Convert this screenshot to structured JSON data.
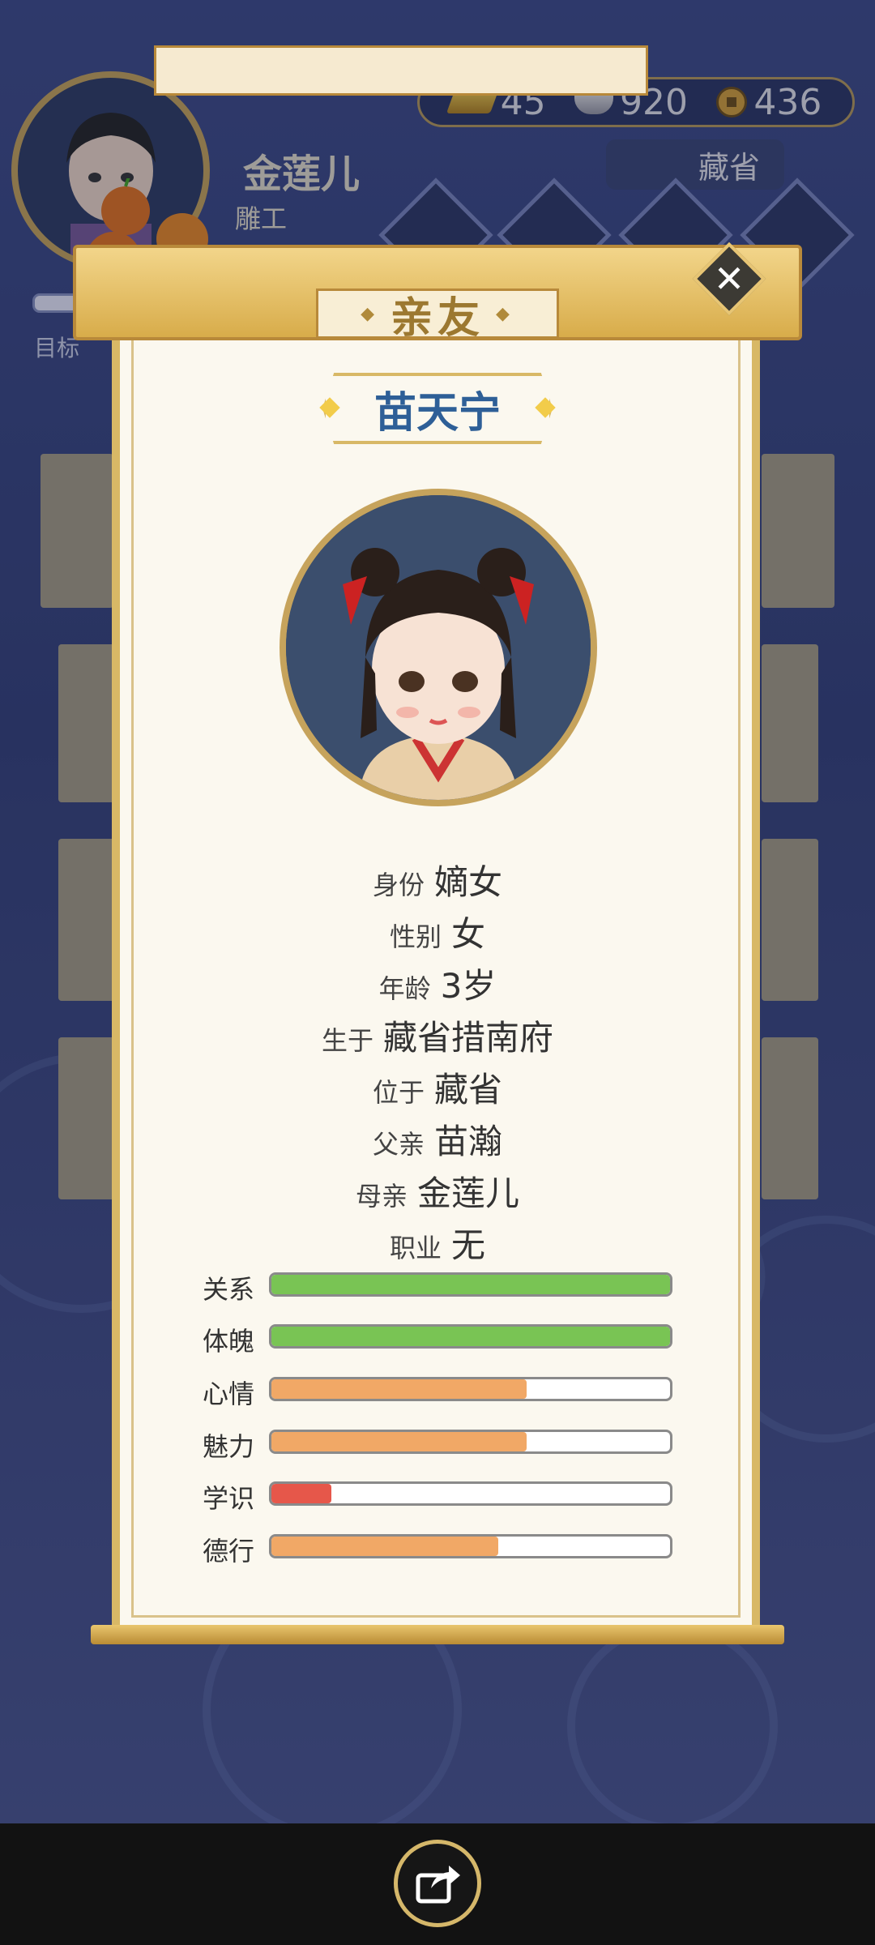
{
  "header": {
    "player_name": "金莲儿",
    "player_sub": "雕工",
    "goal_label": "目标",
    "region_label": "藏省",
    "currency": {
      "gold": "45",
      "silver": "920",
      "coins": "436"
    }
  },
  "modal": {
    "title": "亲友",
    "person_name": "苗天宁",
    "info": [
      {
        "label": "身份",
        "value": "嫡女"
      },
      {
        "label": "性别",
        "value": "女"
      },
      {
        "label": "年龄",
        "value": "3岁"
      },
      {
        "label": "生于",
        "value": "藏省措南府"
      },
      {
        "label": "位于",
        "value": "藏省"
      },
      {
        "label": "父亲",
        "value": "苗瀚"
      },
      {
        "label": "母亲",
        "value": "金莲儿"
      },
      {
        "label": "职业",
        "value": "无"
      }
    ],
    "stats": [
      {
        "label": "关系",
        "fraction": 1.0,
        "color": "#79c454"
      },
      {
        "label": "体魄",
        "fraction": 1.0,
        "color": "#79c454"
      },
      {
        "label": "心情",
        "fraction": 0.64,
        "color": "#f1a866"
      },
      {
        "label": "魅力",
        "fraction": 0.64,
        "color": "#f1a866"
      },
      {
        "label": "学识",
        "fraction": 0.15,
        "color": "#e6574a"
      },
      {
        "label": "德行",
        "fraction": 0.57,
        "color": "#f1a866"
      }
    ]
  },
  "colors": {
    "gold_accent": "#d8b866",
    "name_blue": "#2e5f97"
  }
}
